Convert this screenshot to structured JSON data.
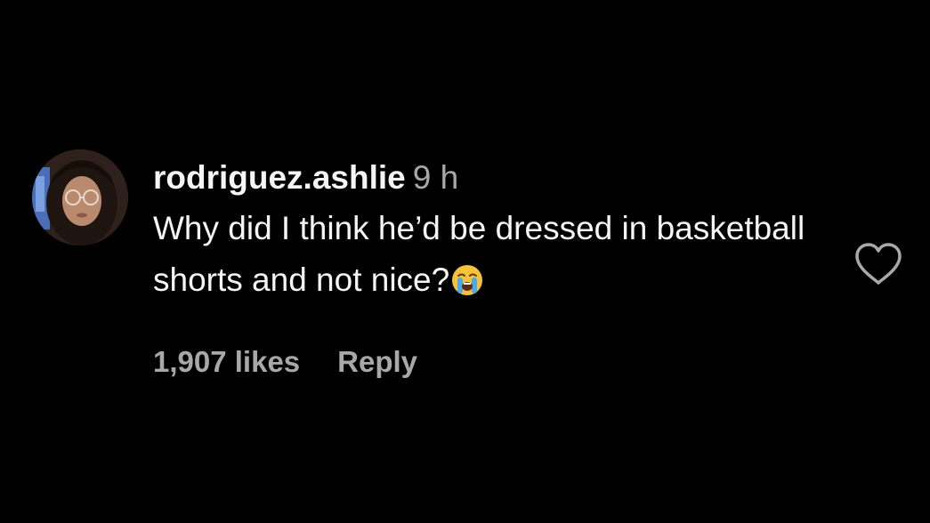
{
  "comment": {
    "username": "rodriguez.ashlie",
    "time": "9 h",
    "text": "Why did I think he’d be dressed in basketball shorts and not nice?",
    "emoji": "loudly-crying-face",
    "likes": "1,907 likes",
    "reply_label": "Reply",
    "like_icon": "heart-outline-icon"
  },
  "colors": {
    "background": "#000000",
    "primary_text": "#f5f5f5",
    "secondary_text": "#a8a8a8"
  }
}
